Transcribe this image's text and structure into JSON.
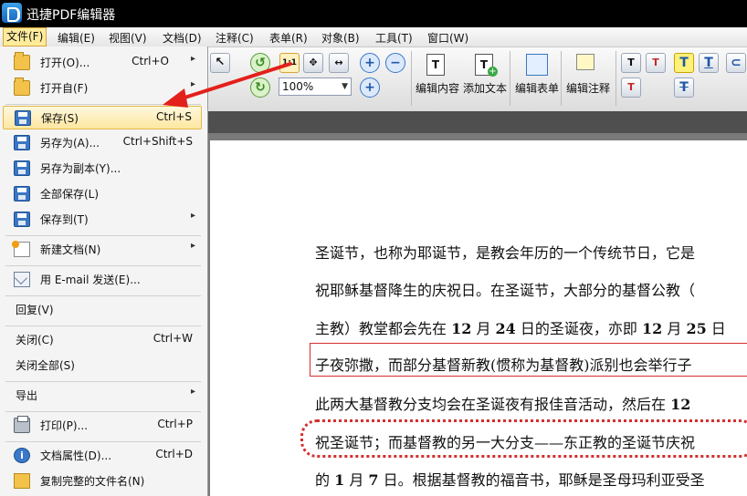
{
  "window": {
    "title": "迅捷PDF编辑器"
  },
  "menubar": [
    {
      "label": "文件(F)"
    },
    {
      "label": "编辑(E)"
    },
    {
      "label": "视图(V)"
    },
    {
      "label": "文档(D)"
    },
    {
      "label": "注释(C)"
    },
    {
      "label": "表单(R)"
    },
    {
      "label": "对象(B)"
    },
    {
      "label": "工具(T)"
    },
    {
      "label": "窗口(W)"
    }
  ],
  "toolbar": {
    "zoom_value": "100%",
    "edit_content": "编辑内容",
    "add_text": "添加文本",
    "edit_form": "编辑表单",
    "edit_annotation": "编辑注释"
  },
  "file_menu": [
    {
      "label": "打开(O)...",
      "shortcut": "Ctrl+O",
      "submenu": "▸",
      "icon": "folder-open-icon"
    },
    {
      "label": "打开自(F)",
      "shortcut": "",
      "submenu": "▸",
      "icon": "folder-open-from-icon"
    },
    {
      "label": "保存(S)",
      "shortcut": "Ctrl+S",
      "submenu": "",
      "icon": "floppy-disk-icon",
      "highlighted": true
    },
    {
      "label": "另存为(A)...",
      "shortcut": "Ctrl+Shift+S",
      "submenu": "",
      "icon": "floppy-save-as-icon"
    },
    {
      "label": "另存为副本(Y)...",
      "shortcut": "",
      "submenu": "",
      "icon": "floppy-copy-icon"
    },
    {
      "label": "全部保存(L)",
      "shortcut": "",
      "submenu": "",
      "icon": "floppy-multi-icon"
    },
    {
      "label": "保存到(T)",
      "shortcut": "",
      "submenu": "▸",
      "icon": "floppy-save-to-icon"
    },
    {
      "label": "新建文档(N)",
      "shortcut": "",
      "submenu": "▸",
      "icon": "new-document-icon"
    },
    {
      "label": "用 E-mail 发送(E)...",
      "shortcut": "",
      "submenu": "",
      "icon": "email-icon"
    },
    {
      "label": "回复(V)",
      "shortcut": "",
      "submenu": ""
    },
    {
      "label": "关闭(C)",
      "shortcut": "Ctrl+W",
      "submenu": ""
    },
    {
      "label": "关闭全部(S)",
      "shortcut": "",
      "submenu": ""
    },
    {
      "label": "导出",
      "shortcut": "",
      "submenu": "▸"
    },
    {
      "label": "打印(P)...",
      "shortcut": "Ctrl+P",
      "submenu": "",
      "icon": "printer-icon"
    },
    {
      "label": "文档属性(D)...",
      "shortcut": "Ctrl+D",
      "submenu": "",
      "icon": "info-icon"
    },
    {
      "label": "复制完整的文件名(N)",
      "shortcut": "",
      "submenu": "",
      "icon": "copy-filename-icon"
    }
  ],
  "document": {
    "lines": [
      {
        "segments": [
          "圣诞节，也称为耶诞节，是教会年历的一个传统节日，它是"
        ]
      },
      {
        "segments": [
          "祝耶稣基督降生的庆祝日。在圣诞节，大部分的基督公教（"
        ]
      },
      {
        "segments": [
          "主教）教堂都会先在 ",
          "12",
          " 月 ",
          "24",
          " 日的圣诞夜，亦即 ",
          "12",
          " 月 ",
          "25",
          " 日"
        ]
      },
      {
        "segments": [
          "子夜弥撒，而部分基督新教(惯称为基督教)派别也会举行子"
        ]
      },
      {
        "segments": [
          "此两大基督教分支均会在圣诞夜有报佳音活动，然后在 ",
          "12",
          " "
        ]
      },
      {
        "segments": [
          "祝圣诞节；而基督教的另一大分支——东正教的圣诞节庆祝"
        ]
      },
      {
        "segments": [
          "的 ",
          "1",
          " 月 ",
          "7",
          " 日。根据基督教的福音书，耶稣是圣母玛利亚受圣"
        ]
      }
    ]
  }
}
